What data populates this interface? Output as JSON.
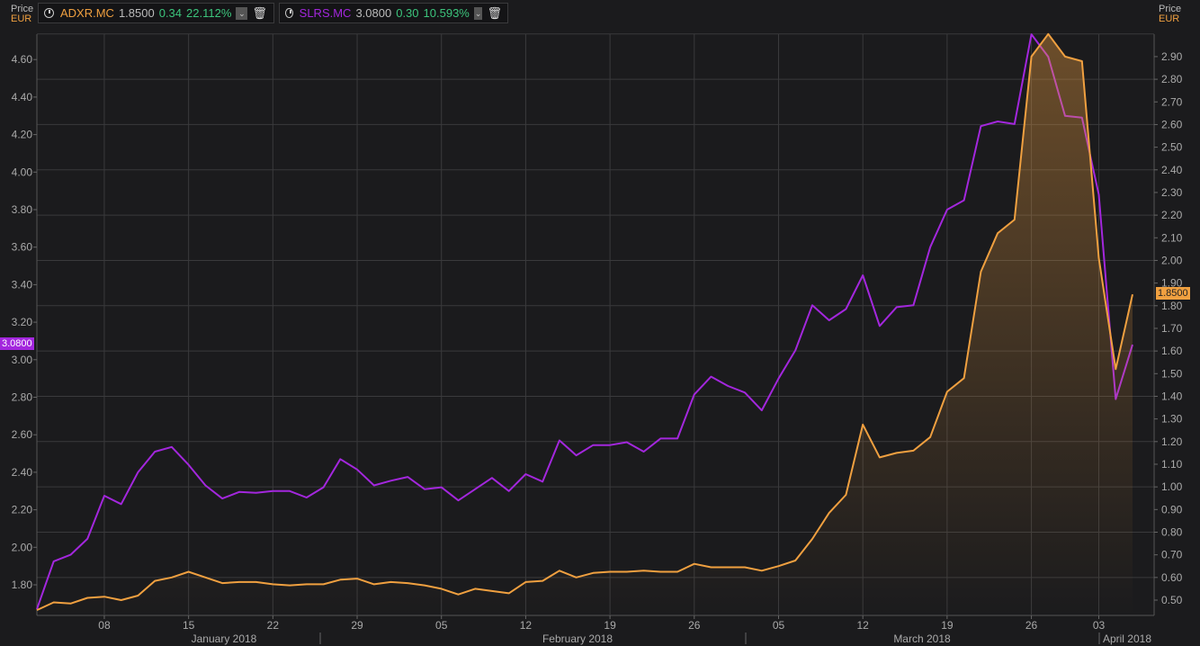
{
  "colors": {
    "bg": "#1b1b1d",
    "grid": "#3a3a3c",
    "adxr": "#f0a040",
    "slrs": "#a327dd",
    "up": "#3cc47c"
  },
  "left_axis": {
    "title": "Price",
    "unit": "EUR"
  },
  "right_axis": {
    "title": "Price",
    "unit": "EUR"
  },
  "legend": [
    {
      "ticker": "ADXR.MC",
      "price": "1.8500",
      "change": "0.34",
      "pct": "22.112%",
      "icon": "clock-icon",
      "dropdown": "chevron-down-icon",
      "delete": "trash-icon"
    },
    {
      "ticker": "SLRS.MC",
      "price": "3.0800",
      "change": "0.30",
      "pct": "10.593%",
      "icon": "clock-icon",
      "dropdown": "chevron-down-icon",
      "delete": "trash-icon"
    }
  ],
  "tags": {
    "slrs": "3.0800",
    "adxr": "1.8500"
  },
  "chart_data": {
    "type": "line",
    "x_tick_labels": [
      "08",
      "15",
      "22",
      "29",
      "05",
      "12",
      "19",
      "26",
      "05",
      "12",
      "19",
      "26",
      "03"
    ],
    "x_tick_index": [
      4,
      9,
      14,
      19,
      24,
      29,
      34,
      39,
      44,
      49,
      54,
      59,
      63
    ],
    "months": [
      "January 2018",
      "February 2018",
      "March 2018",
      "April 2018"
    ],
    "left_ylim": [
      1.66,
      4.74
    ],
    "left_ticks": [
      1.8,
      2.0,
      2.2,
      2.4,
      2.6,
      2.8,
      3.0,
      3.2,
      3.4,
      3.6,
      3.8,
      4.0,
      4.2,
      4.4,
      4.6
    ],
    "right_ylim": [
      0.43,
      3.0
    ],
    "right_ticks": [
      0.5,
      0.6,
      0.7,
      0.8,
      0.9,
      1.0,
      1.1,
      1.2,
      1.3,
      1.4,
      1.5,
      1.6,
      1.7,
      1.8,
      1.9,
      2.0,
      2.1,
      2.2,
      2.3,
      2.4,
      2.5,
      2.6,
      2.7,
      2.8,
      2.9
    ],
    "grid": true,
    "series": [
      {
        "name": "SLRS.MC",
        "axis": "left",
        "values": [
          1.67,
          1.925,
          1.96,
          2.045,
          2.275,
          2.23,
          2.4,
          2.51,
          2.535,
          2.44,
          2.33,
          2.26,
          2.295,
          2.29,
          2.3,
          2.3,
          2.265,
          2.32,
          2.47,
          2.415,
          2.33,
          2.355,
          2.375,
          2.31,
          2.32,
          2.25,
          2.31,
          2.37,
          2.3,
          2.39,
          2.35,
          2.57,
          2.49,
          2.545,
          2.545,
          2.56,
          2.51,
          2.58,
          2.58,
          2.815,
          2.91,
          2.86,
          2.825,
          2.73,
          2.9,
          3.05,
          3.29,
          3.21,
          3.27,
          3.45,
          3.18,
          3.28,
          3.29,
          3.6,
          3.8,
          3.85,
          4.245,
          4.27,
          4.256,
          4.735,
          4.615,
          4.3,
          4.29,
          3.88,
          2.79,
          3.08
        ]
      },
      {
        "name": "ADXR.MC",
        "axis": "right",
        "values": [
          0.456,
          0.49,
          0.485,
          0.51,
          0.515,
          0.5,
          0.52,
          0.585,
          0.6,
          0.625,
          0.6,
          0.575,
          0.58,
          0.58,
          0.57,
          0.565,
          0.57,
          0.57,
          0.59,
          0.595,
          0.57,
          0.58,
          0.575,
          0.565,
          0.55,
          0.525,
          0.55,
          0.54,
          0.53,
          0.58,
          0.585,
          0.63,
          0.6,
          0.62,
          0.625,
          0.625,
          0.63,
          0.625,
          0.625,
          0.66,
          0.645,
          0.645,
          0.645,
          0.63,
          0.65,
          0.675,
          0.77,
          0.885,
          0.965,
          1.275,
          1.13,
          1.15,
          1.16,
          1.22,
          1.42,
          1.48,
          1.95,
          2.12,
          2.18,
          2.9,
          3.0,
          2.9,
          2.88,
          2.01,
          1.52,
          1.85
        ]
      }
    ]
  }
}
